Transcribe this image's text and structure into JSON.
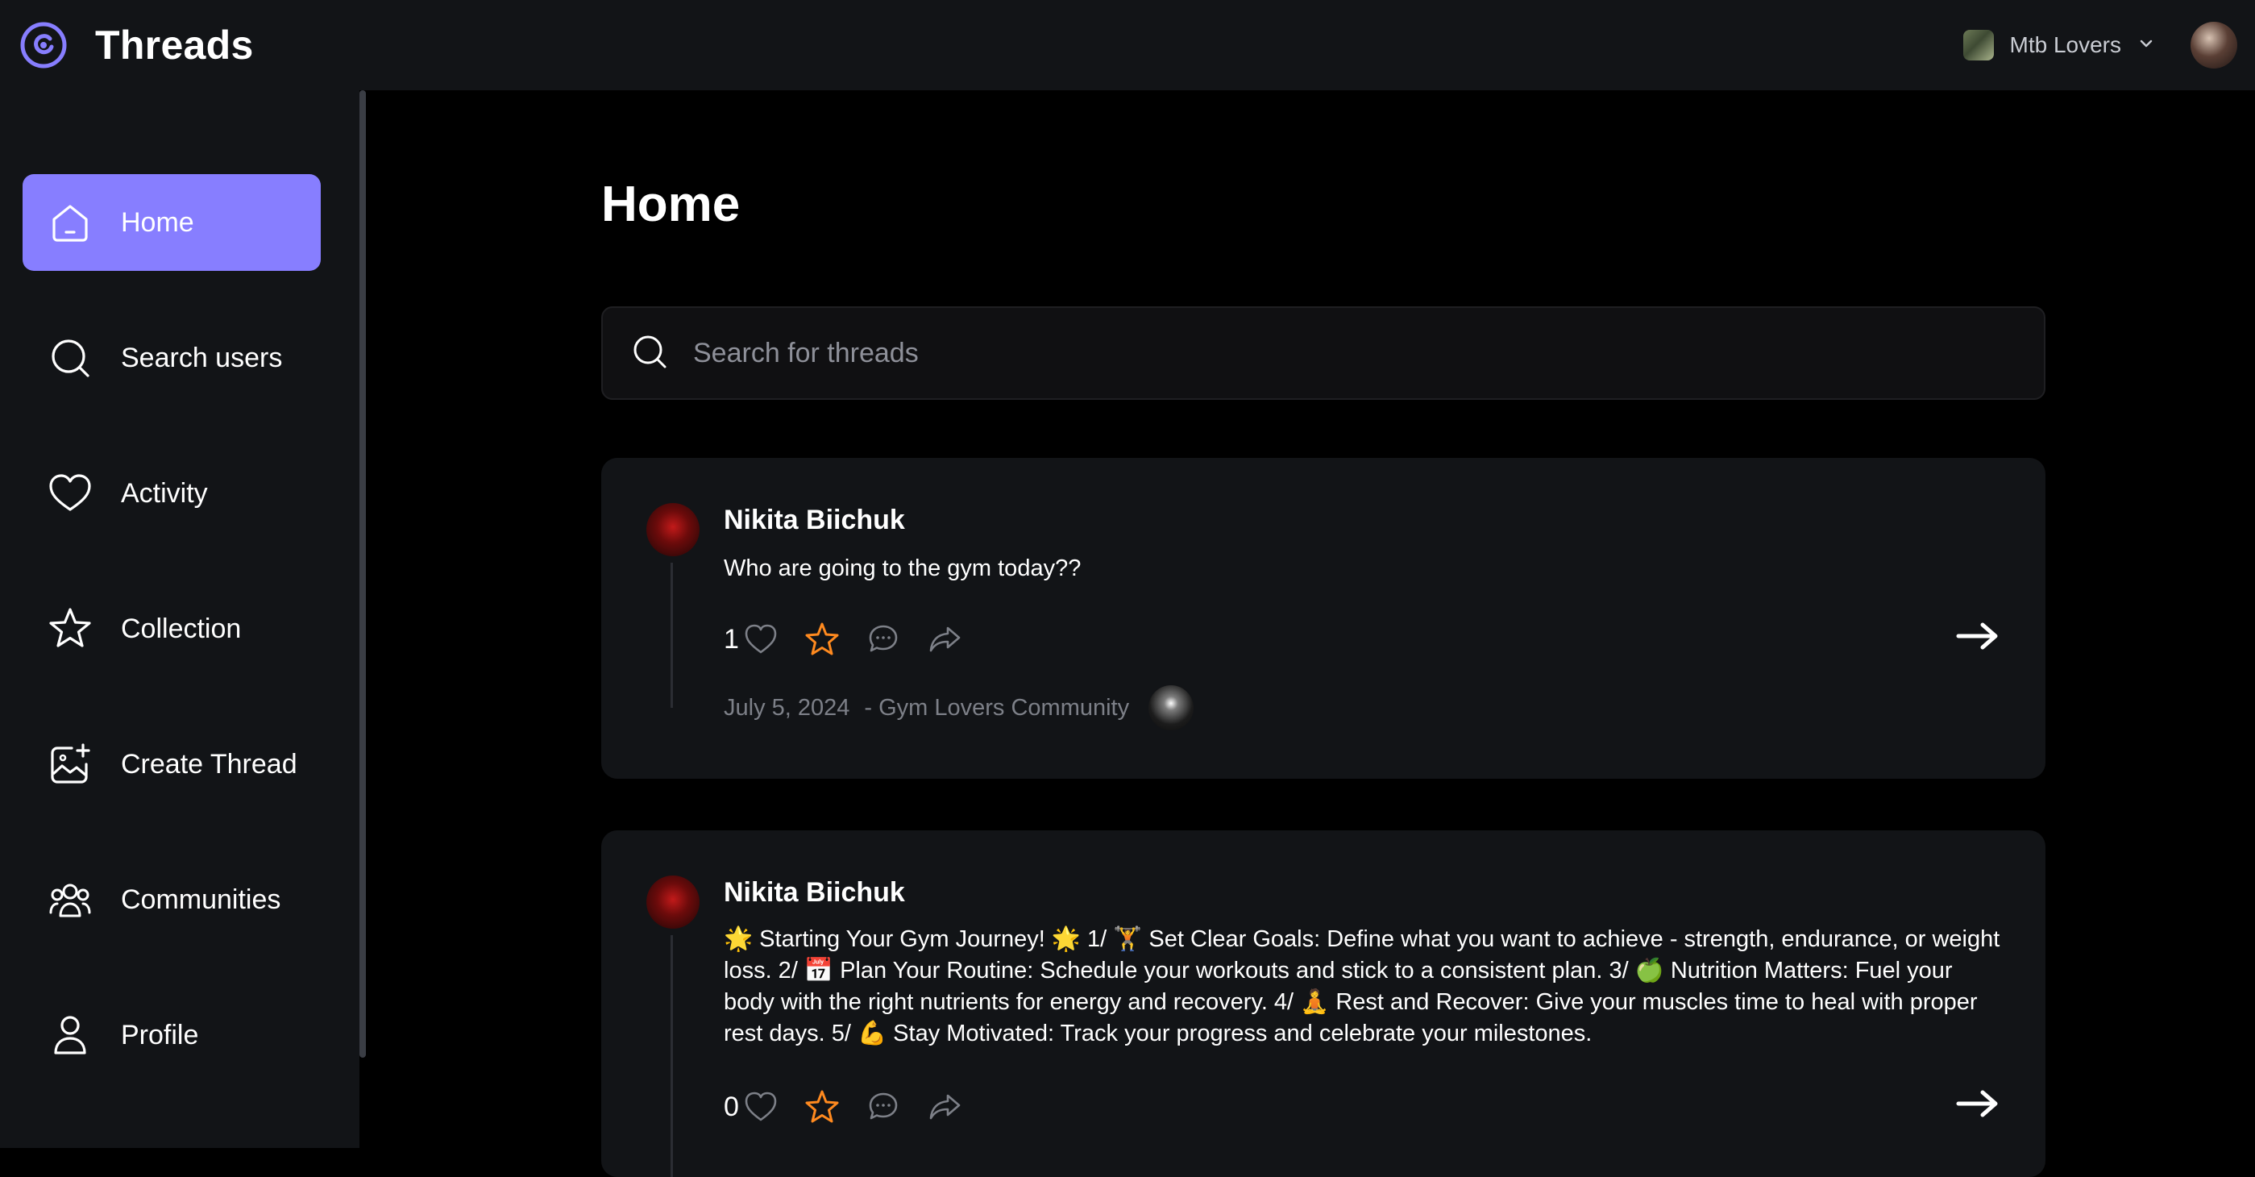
{
  "app": {
    "title": "Threads"
  },
  "topbar": {
    "org_name": "Mtb Lovers"
  },
  "sidebar": {
    "items": [
      {
        "label": "Home",
        "icon": "home-icon",
        "active": true
      },
      {
        "label": "Search users",
        "icon": "search-icon",
        "active": false
      },
      {
        "label": "Activity",
        "icon": "heart-icon",
        "active": false
      },
      {
        "label": "Collection",
        "icon": "star-icon",
        "active": false
      },
      {
        "label": "Create Thread",
        "icon": "create-icon",
        "active": false
      },
      {
        "label": "Communities",
        "icon": "community-icon",
        "active": false
      },
      {
        "label": "Profile",
        "icon": "user-icon",
        "active": false
      }
    ]
  },
  "main": {
    "title": "Home",
    "search": {
      "placeholder": "Search for threads",
      "value": ""
    },
    "threads": [
      {
        "author": "Nikita Biichuk",
        "text": "Who are going to the gym today??",
        "likes": "1",
        "date": "July 5, 2024",
        "community": "- Gym Lovers Community"
      },
      {
        "author": "Nikita Biichuk",
        "text": "🌟 Starting Your Gym Journey! 🌟 1/ 🏋 Set Clear Goals: Define what you want to achieve - strength, endurance, or weight loss. 2/ 📅 Plan Your Routine: Schedule your workouts and stick to a consistent plan. 3/ 🍏 Nutrition Matters: Fuel your body with the right nutrients for energy and recovery. 4/ 🧘 Rest and Recover: Give your muscles time to heal with proper rest days. 5/ 💪 Stay Motivated: Track your progress and celebrate your milestones.",
        "likes": "0"
      }
    ]
  },
  "colors": {
    "accent": "#877eff",
    "star": "#ff8a1f",
    "panel": "#121417",
    "background": "#000000",
    "muted": "#7d8088"
  }
}
